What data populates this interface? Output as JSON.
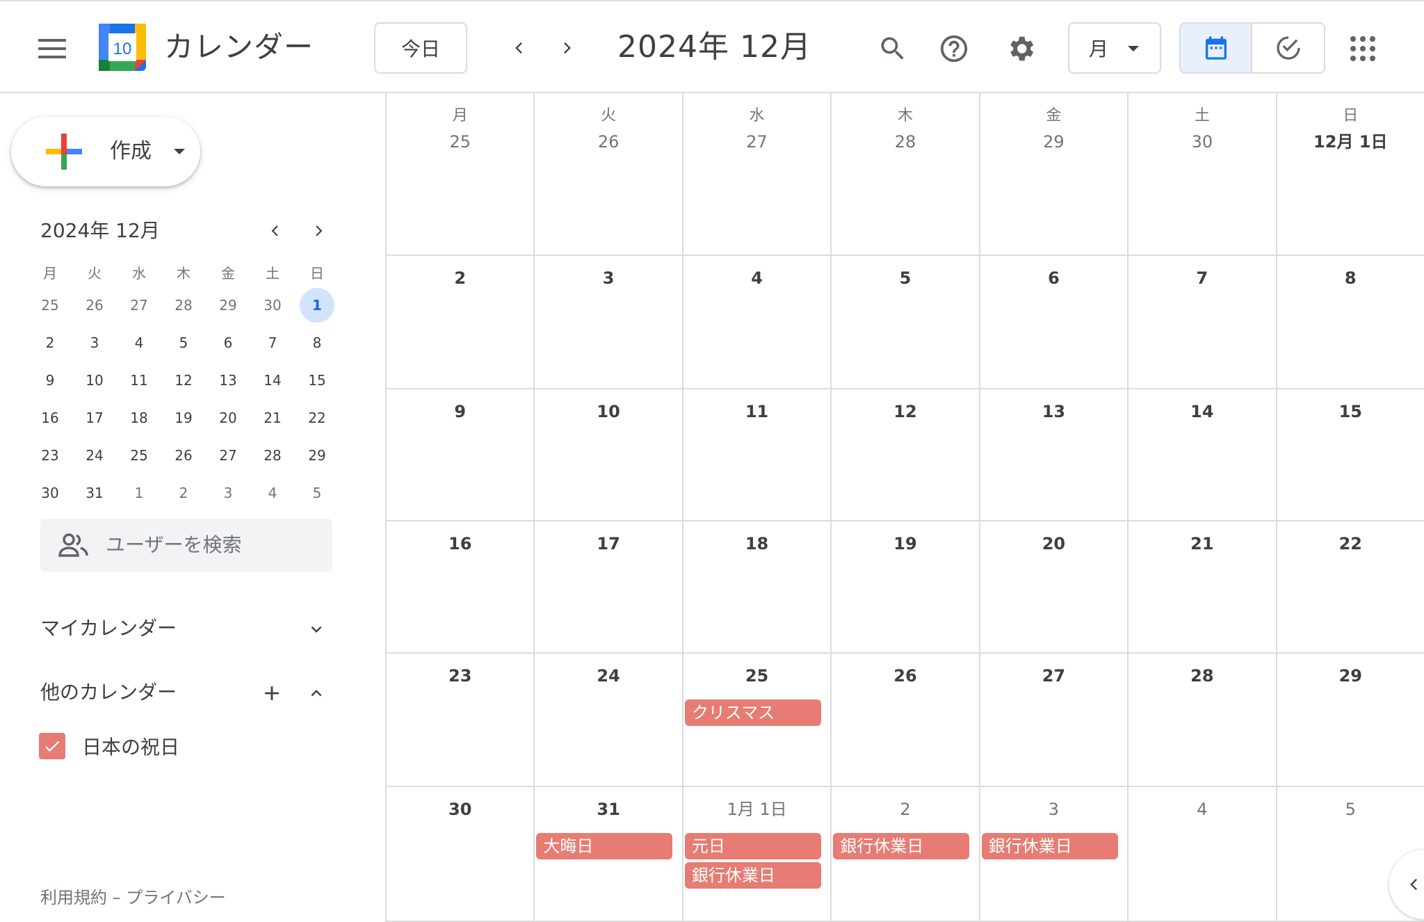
{
  "header": {
    "app_title": "カレンダー",
    "logo_day": "10",
    "today_label": "今日",
    "current_month": "2024年 12月",
    "view_mode": "月"
  },
  "sidebar": {
    "create_label": "作成",
    "mini_calendar": {
      "title": "2024年 12月",
      "weekdays": [
        "月",
        "火",
        "水",
        "木",
        "金",
        "土",
        "日"
      ],
      "weeks": [
        [
          "25",
          "26",
          "27",
          "28",
          "29",
          "30",
          "1"
        ],
        [
          "2",
          "3",
          "4",
          "5",
          "6",
          "7",
          "8"
        ],
        [
          "9",
          "10",
          "11",
          "12",
          "13",
          "14",
          "15"
        ],
        [
          "16",
          "17",
          "18",
          "19",
          "20",
          "21",
          "22"
        ],
        [
          "23",
          "24",
          "25",
          "26",
          "27",
          "28",
          "29"
        ],
        [
          "30",
          "31",
          "1",
          "2",
          "3",
          "4",
          "5"
        ]
      ],
      "today": "1"
    },
    "search_users_placeholder": "ユーザーを検索",
    "my_calendars_label": "マイカレンダー",
    "other_calendars_label": "他のカレンダー",
    "calendars": [
      {
        "name": "日本の祝日",
        "color": "#e67c73",
        "checked": true
      }
    ],
    "footer": "利用規約 – プライバシー"
  },
  "month_grid": {
    "weekdays": [
      "月",
      "火",
      "水",
      "木",
      "金",
      "土",
      "日"
    ],
    "weeks": [
      [
        "25",
        "26",
        "27",
        "28",
        "29",
        "30",
        "12月 1日"
      ],
      [
        "2",
        "3",
        "4",
        "5",
        "6",
        "7",
        "8"
      ],
      [
        "9",
        "10",
        "11",
        "12",
        "13",
        "14",
        "15"
      ],
      [
        "16",
        "17",
        "18",
        "19",
        "20",
        "21",
        "22"
      ],
      [
        "23",
        "24",
        "25",
        "26",
        "27",
        "28",
        "29"
      ],
      [
        "30",
        "31",
        "1月 1日",
        "2",
        "3",
        "4",
        "5"
      ]
    ],
    "events": [
      {
        "week": 4,
        "day": 2,
        "slot": 0,
        "title": "クリスマス"
      },
      {
        "week": 5,
        "day": 1,
        "slot": 0,
        "title": "大晦日"
      },
      {
        "week": 5,
        "day": 2,
        "slot": 0,
        "title": "元日"
      },
      {
        "week": 5,
        "day": 2,
        "slot": 1,
        "title": "銀行休業日"
      },
      {
        "week": 5,
        "day": 3,
        "slot": 0,
        "title": "銀行休業日"
      },
      {
        "week": 5,
        "day": 4,
        "slot": 0,
        "title": "銀行休業日"
      }
    ],
    "event_color": "#e67c73"
  },
  "colors": {
    "accent": "#1a73e8",
    "today_highlight": "#d2e3fc",
    "holiday": "#e67c73",
    "border": "#dadce0"
  },
  "icons": [
    "menu-icon",
    "calendar-logo-icon",
    "chevron-left-icon",
    "chevron-right-icon",
    "search-icon",
    "help-icon",
    "settings-gear-icon",
    "calendar-view-icon",
    "tasks-check-icon",
    "apps-grid-icon",
    "plus-icon",
    "people-icon",
    "chevron-down-icon",
    "chevron-up-icon",
    "checkbox-icon"
  ]
}
